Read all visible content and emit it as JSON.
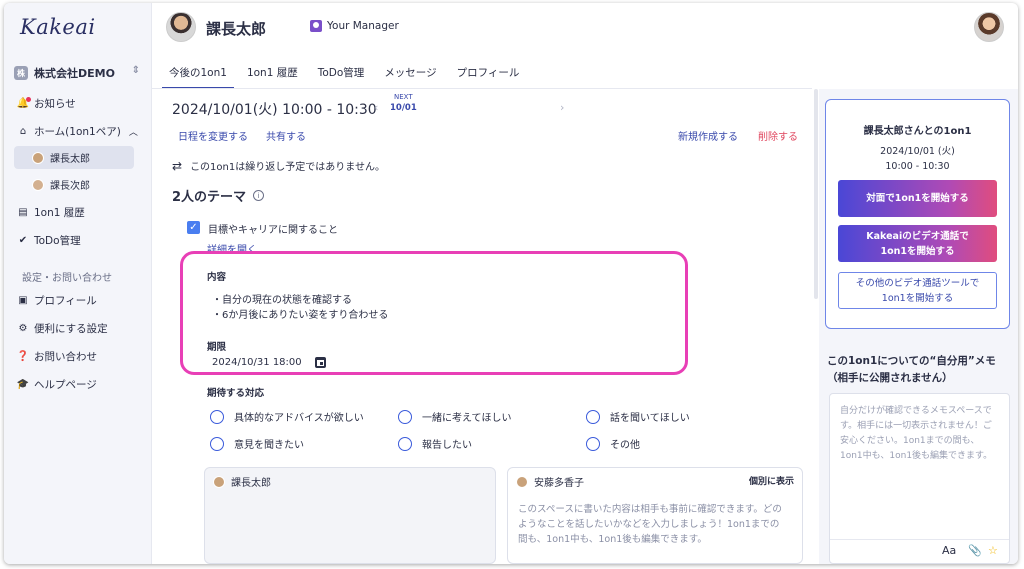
{
  "app": {
    "logo": "Kakeai"
  },
  "sidebar": {
    "company": "株式会社DEMO",
    "company_icon": "株",
    "items": [
      {
        "label": "お知らせ",
        "icon": "bell-icon"
      },
      {
        "label": "ホーム(1on1ペア)",
        "icon": "home-icon"
      },
      {
        "label": "課長太郎",
        "icon": "avatar"
      },
      {
        "label": "課長次郎",
        "icon": "avatar"
      },
      {
        "label": "1on1 履歴",
        "icon": "history-icon"
      },
      {
        "label": "ToDo管理",
        "icon": "check-circle-icon"
      }
    ],
    "settings_section": "設定・お問い合わせ",
    "settings_items": [
      {
        "label": "プロフィール",
        "icon": "profile-icon"
      },
      {
        "label": "便利にする設定",
        "icon": "gear-icon"
      },
      {
        "label": "お問い合わせ",
        "icon": "question-icon"
      },
      {
        "label": "ヘルプページ",
        "icon": "graduation-cap-icon"
      }
    ]
  },
  "header": {
    "user_name": "課長太郎",
    "role": "Your Manager",
    "tabs": [
      "今後の1on1",
      "1on1 履歴",
      "ToDo管理",
      "メッセージ",
      "プロフィール"
    ]
  },
  "main": {
    "datetime": "2024/10/01(火)  10:00 - 10:30",
    "pager": {
      "next_label": "NEXT",
      "next_date": "10/01"
    },
    "reschedule": "日程を変更する",
    "share": "共有する",
    "create_new": "新規作成する",
    "delete": "削除する",
    "no_repeat": "この1on1は繰り返し予定ではありません。",
    "theme_title": "2人のテーマ",
    "theme_item": "目標やキャリアに関すること",
    "show_detail": "詳細を開く",
    "content_label": "内容",
    "content_lines": [
      "・自分の現在の状態を確認する",
      "・6か月後にありたい姿をすり合わせる"
    ],
    "deadline_label": "期限",
    "deadline_value": "2024/10/31 18:00",
    "expect_label": "期待する対応",
    "expect_options": [
      "具体的なアドバイスが欲しい",
      "一緒に考えてほしい",
      "話を聞いてほしい",
      "意見を聞きたい",
      "報告したい",
      "その他"
    ],
    "memo_left_name": "課長太郎",
    "memo_right_name": "安藤多香子",
    "memo_right_toggle": "個別に表示",
    "memo_right_placeholder": "このスペースに書いた内容は相手も事前に確認できます。どのようなことを話したいかなどを入力しましょう！1on1までの間も、1on1中も、1on1後も編集できます。"
  },
  "right": {
    "card_title": "課長太郎さんとの1on1",
    "card_date": "2024/10/01 (火)",
    "card_time": "10:00 - 10:30",
    "btn_face": "対面で1on1を開始する",
    "btn_video_line1": "Kakeaiのビデオ通話で",
    "btn_video_line2": "1on1を開始する",
    "btn_other_line1": "その他のビデオ通話ツールで",
    "btn_other_line2": "1on1を開始する",
    "self_memo_title_line1": "この1on1についての“自分用”メモ",
    "self_memo_title_line2": "（相手に公開されません）",
    "self_memo_placeholder": "自分だけが確認できるメモスペースです。相手には一切表示されません！ご安心ください。1on1までの間も、1on1中も、1on1後も編集できます。",
    "toolbar": {
      "font": "Aa",
      "attach": "📎",
      "star": "☆"
    }
  },
  "colors": {
    "accent": "#3949ab",
    "highlight": "#e83fb6",
    "danger": "#e0475f"
  }
}
